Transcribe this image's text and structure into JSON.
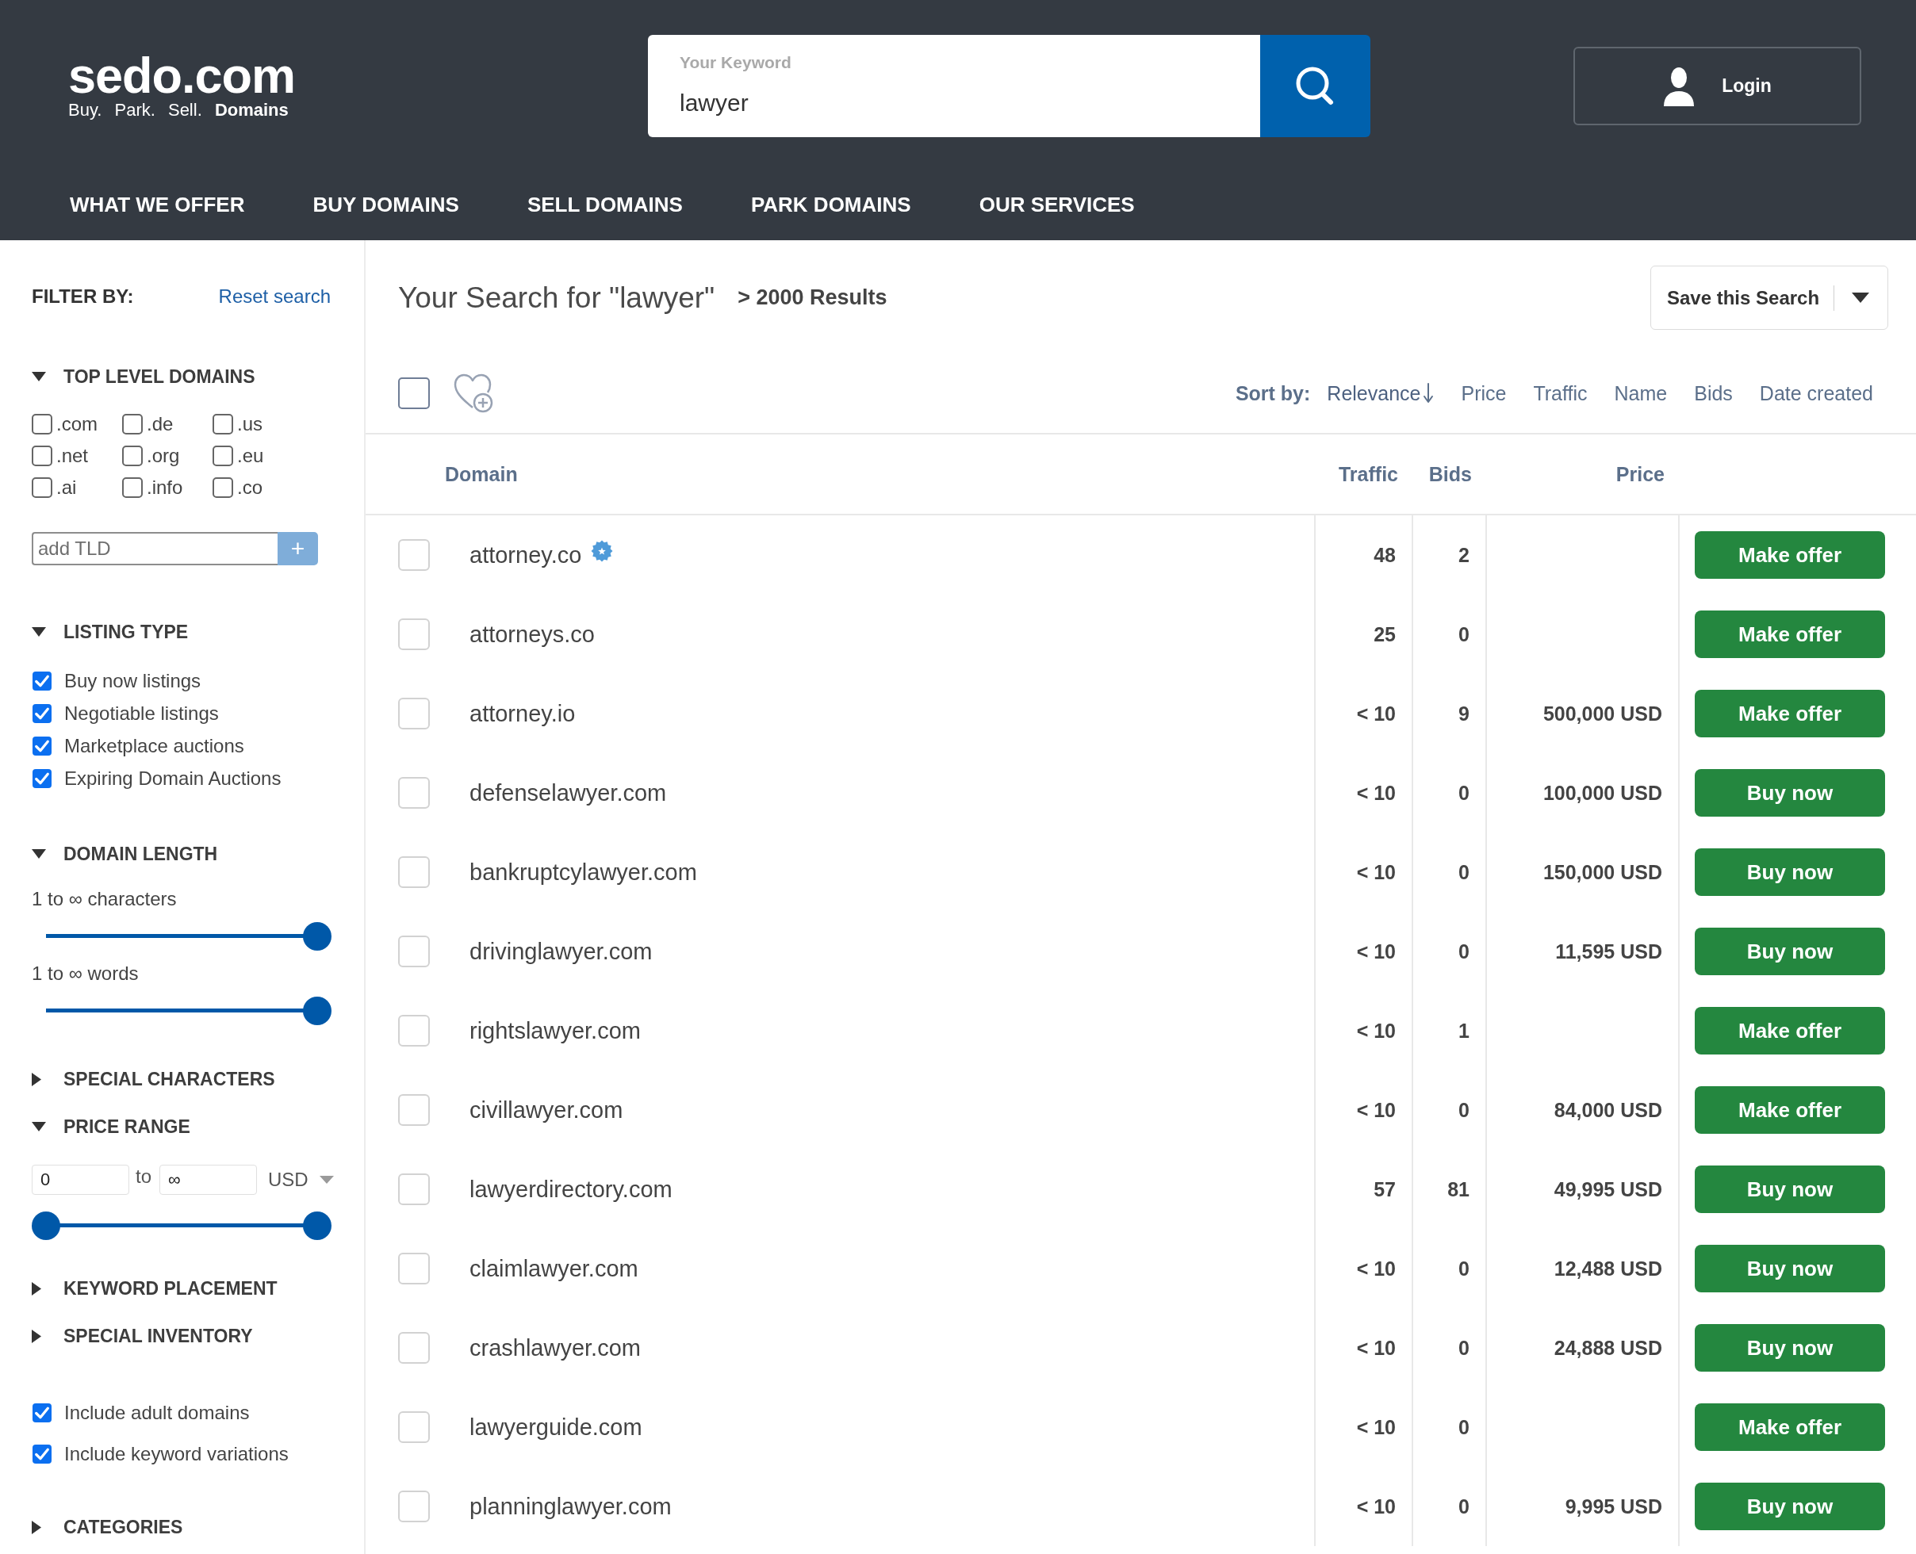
{
  "header": {
    "logo": {
      "wordmark": "sedo.com",
      "tagline": "Buy. Park. Sell. **Domains**"
    },
    "search": {
      "label": "Your Keyword",
      "value": "lawyer"
    },
    "login": {
      "label": "Login"
    }
  },
  "nav": [
    {
      "label": "WHAT WE OFFER"
    },
    {
      "label": "BUY DOMAINS"
    },
    {
      "label": "SELL DOMAINS"
    },
    {
      "label": "PARK DOMAINS"
    },
    {
      "label": "OUR SERVICES"
    }
  ],
  "sidebar": {
    "title": "FILTER BY:",
    "reset_link": "Reset search",
    "sections": [
      {
        "kind": "tld",
        "title": "TOP LEVEL DOMAINS",
        "expanded": true,
        "options": [
          {
            "label": ".com",
            "checked": false
          },
          {
            "label": ".de",
            "checked": false
          },
          {
            "label": ".us",
            "checked": false
          },
          {
            "label": ".net",
            "checked": false
          },
          {
            "label": ".org",
            "checked": false
          },
          {
            "label": ".eu",
            "checked": false
          },
          {
            "label": ".ai",
            "checked": false
          },
          {
            "label": ".info",
            "checked": false
          },
          {
            "label": ".co",
            "checked": false
          }
        ],
        "add_field": {
          "placeholder": "add TLD",
          "button": "+"
        }
      },
      {
        "kind": "checklist",
        "title": "LISTING TYPE",
        "expanded": true,
        "options": [
          {
            "label": "Buy now listings",
            "checked": true
          },
          {
            "label": "Negotiable listings",
            "checked": true
          },
          {
            "label": "Marketplace auctions",
            "checked": true
          },
          {
            "label": "Expiring Domain Auctions",
            "checked": true
          }
        ]
      },
      {
        "kind": "sliders",
        "title": "DOMAIN LENGTH",
        "expanded": true,
        "sliders": [
          {
            "label": "1 to ∞ characters",
            "level": 1
          },
          {
            "label": "1 to ∞ words",
            "level": 1
          }
        ]
      },
      {
        "kind": "collapsible",
        "title": "SPECIAL CHARACTERS",
        "expanded": false
      },
      {
        "kind": "price",
        "title": "PRICE RANGE",
        "expanded": true,
        "min": "0",
        "separator": "to",
        "max": "∞",
        "currency": "USD",
        "level": 1
      },
      {
        "kind": "collapsible",
        "title": "KEYWORD PLACEMENT",
        "expanded": false
      },
      {
        "kind": "collapsible",
        "title": "SPECIAL INVENTORY",
        "expanded": false
      },
      {
        "kind": "checklist",
        "options": [
          {
            "label": "Include adult domains",
            "checked": true
          },
          {
            "label": "Include keyword variations",
            "checked": true
          }
        ]
      },
      {
        "kind": "collapsible",
        "title": "CATEGORIES",
        "expanded": false
      }
    ]
  },
  "results": {
    "title": "Your Search for \"lawyer\"",
    "count": "> 2000 Results",
    "save_button": "Save this Search",
    "select_all": {
      "checked": false
    },
    "sort": {
      "label": "Sort by:",
      "options": [
        {
          "label": "Relevance",
          "selected": true
        },
        {
          "label": "Price",
          "selected": false
        },
        {
          "label": "Traffic",
          "selected": false
        },
        {
          "label": "Name",
          "selected": false
        },
        {
          "label": "Bids",
          "selected": false
        },
        {
          "label": "Date created",
          "selected": false
        }
      ]
    },
    "table": {
      "columns": [
        "Domain",
        "Traffic",
        "Bids",
        "Price"
      ],
      "rows": [
        {
          "checked": false,
          "domain": "attorney.co",
          "seal_badge": true,
          "traffic": "48",
          "bids": "2",
          "action": "Make offer"
        },
        {
          "checked": false,
          "domain": "attorneys.co",
          "seal_badge": false,
          "traffic": "25",
          "bids": "0",
          "action": "Make offer"
        },
        {
          "checked": false,
          "domain": "attorney.io",
          "seal_badge": false,
          "traffic": "< 10",
          "bids": "9",
          "price": "500,000 USD",
          "action": "Make offer"
        },
        {
          "checked": false,
          "domain": "defenselawyer.com",
          "seal_badge": false,
          "traffic": "< 10",
          "bids": "0",
          "price": "100,000 USD",
          "action": "Buy now"
        },
        {
          "checked": false,
          "domain": "bankruptcylawyer.com",
          "seal_badge": false,
          "traffic": "< 10",
          "bids": "0",
          "price": "150,000 USD",
          "action": "Buy now"
        },
        {
          "checked": false,
          "domain": "drivinglawyer.com",
          "seal_badge": false,
          "traffic": "< 10",
          "bids": "0",
          "price": "11,595 USD",
          "action": "Buy now"
        },
        {
          "checked": false,
          "domain": "rightslawyer.com",
          "seal_badge": false,
          "traffic": "< 10",
          "bids": "1",
          "action": "Make offer"
        },
        {
          "checked": false,
          "domain": "civillawyer.com",
          "seal_badge": false,
          "traffic": "< 10",
          "bids": "0",
          "price": "84,000 USD",
          "action": "Make offer"
        },
        {
          "checked": false,
          "domain": "lawyerdirectory.com",
          "seal_badge": false,
          "traffic": "57",
          "bids": "81",
          "price": "49,995 USD",
          "action": "Buy now"
        },
        {
          "checked": false,
          "domain": "claimlawyer.com",
          "seal_badge": false,
          "traffic": "< 10",
          "bids": "0",
          "price": "12,488 USD",
          "action": "Buy now"
        },
        {
          "checked": false,
          "domain": "crashlawyer.com",
          "seal_badge": false,
          "traffic": "< 10",
          "bids": "0",
          "price": "24,888 USD",
          "action": "Buy now"
        },
        {
          "checked": false,
          "domain": "lawyerguide.com",
          "seal_badge": false,
          "traffic": "< 10",
          "bids": "0",
          "action": "Make offer"
        },
        {
          "checked": false,
          "domain": "planninglawyer.com",
          "seal_badge": false,
          "traffic": "< 10",
          "bids": "0",
          "price": "9,995 USD",
          "action": "Buy now"
        }
      ]
    }
  }
}
